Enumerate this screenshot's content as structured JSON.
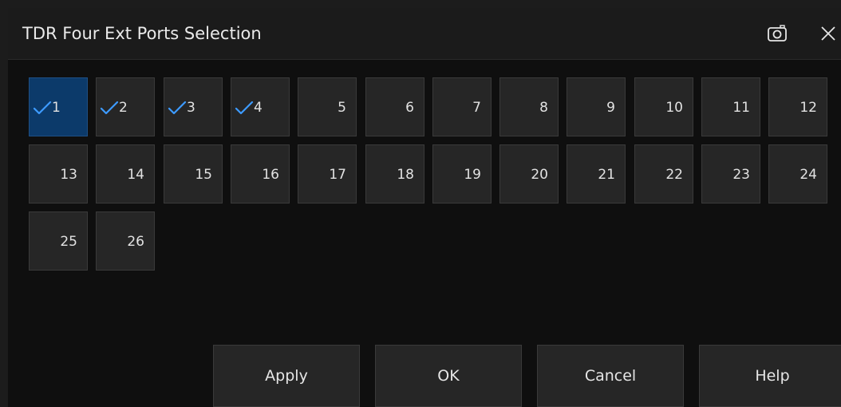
{
  "dialog": {
    "title": "TDR Four Ext Ports Selection",
    "icons": {
      "camera": "camera-icon",
      "close": "close-icon"
    }
  },
  "ports": [
    {
      "label": "1",
      "checked": true
    },
    {
      "label": "2",
      "checked": true
    },
    {
      "label": "3",
      "checked": true
    },
    {
      "label": "4",
      "checked": true
    },
    {
      "label": "5",
      "checked": false
    },
    {
      "label": "6",
      "checked": false
    },
    {
      "label": "7",
      "checked": false
    },
    {
      "label": "8",
      "checked": false
    },
    {
      "label": "9",
      "checked": false
    },
    {
      "label": "10",
      "checked": false
    },
    {
      "label": "11",
      "checked": false
    },
    {
      "label": "12",
      "checked": false
    },
    {
      "label": "13",
      "checked": false
    },
    {
      "label": "14",
      "checked": false
    },
    {
      "label": "15",
      "checked": false
    },
    {
      "label": "16",
      "checked": false
    },
    {
      "label": "17",
      "checked": false
    },
    {
      "label": "18",
      "checked": false
    },
    {
      "label": "19",
      "checked": false
    },
    {
      "label": "20",
      "checked": false
    },
    {
      "label": "21",
      "checked": false
    },
    {
      "label": "22",
      "checked": false
    },
    {
      "label": "23",
      "checked": false
    },
    {
      "label": "24",
      "checked": false
    },
    {
      "label": "25",
      "checked": false
    },
    {
      "label": "26",
      "checked": false
    }
  ],
  "buttons": {
    "apply": "Apply",
    "ok": "OK",
    "cancel": "Cancel",
    "help": "Help"
  },
  "colors": {
    "accent_check": "#3d9bff",
    "selected_focus": "#0c3a6a",
    "background": "#0f0f0f",
    "button_bg": "#262626"
  }
}
